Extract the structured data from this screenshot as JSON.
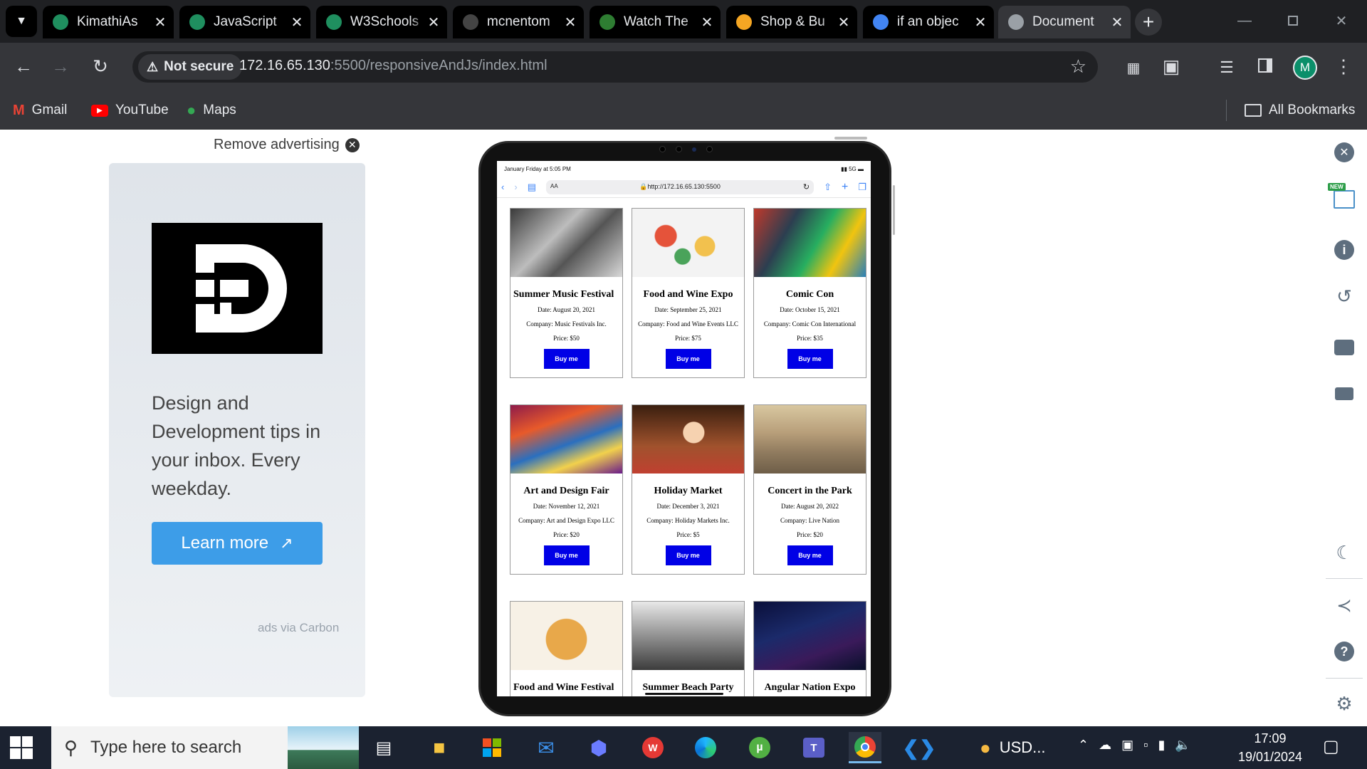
{
  "tabs": [
    {
      "title": "KimathiAs",
      "icon": "webflow-icon",
      "color": "#1f8f5f"
    },
    {
      "title": "JavaScript",
      "icon": "webflow-icon",
      "color": "#1f8f5f"
    },
    {
      "title": "W3Schools",
      "icon": "webflow-icon",
      "color": "#1f8f5f"
    },
    {
      "title": "mcnentom",
      "icon": "github-icon",
      "color": "#444"
    },
    {
      "title": "Watch The",
      "icon": "play-icon",
      "color": "#2e7d32"
    },
    {
      "title": "Shop & Bu",
      "icon": "star-icon",
      "color": "#f5a623"
    },
    {
      "title": "if an objec",
      "icon": "google-icon",
      "color": "#4285f4"
    },
    {
      "title": "Document",
      "icon": "globe-icon",
      "color": "#9aa0a6"
    }
  ],
  "address": {
    "security": "Not secure",
    "host": "172.16.65.130",
    "path": ":5500/responsiveAndJs/index.html"
  },
  "profile_initial": "M",
  "bookmarks": [
    {
      "label": "Gmail"
    },
    {
      "label": "YouTube"
    },
    {
      "label": "Maps"
    }
  ],
  "all_bookmarks": "All Bookmarks",
  "ad": {
    "remove": "Remove advertising",
    "text": "Design and Development tips in your inbox. Every weekday.",
    "button": "Learn more",
    "via": "ads via Carbon"
  },
  "device": {
    "status_left": "January Friday at 5:05 PM",
    "status_right": "5G",
    "url": "http://172.16.65.130:5500",
    "text_size": "AA"
  },
  "events": [
    {
      "title": "Summer Music Festival",
      "date": "Date: August 20, 2021",
      "company": "Company: Music Festivals Inc.",
      "price": "Price: $50",
      "button": "Buy me"
    },
    {
      "title": "Food and Wine Expo",
      "date": "Date: September 25, 2021",
      "company": "Company: Food and Wine Events LLC",
      "price": "Price: $75",
      "button": "Buy me"
    },
    {
      "title": "Comic Con",
      "date": "Date: October 15, 2021",
      "company": "Company: Comic Con International",
      "price": "Price: $35",
      "button": "Buy me"
    },
    {
      "title": "Art and Design Fair",
      "date": "Date: November 12, 2021",
      "company": "Company: Art and Design Expo LLC",
      "price": "Price: $20",
      "button": "Buy me"
    },
    {
      "title": "Holiday Market",
      "date": "Date: December 3, 2021",
      "company": "Company: Holiday Markets Inc.",
      "price": "Price: $5",
      "button": "Buy me"
    },
    {
      "title": "Concert in the Park",
      "date": "Date: August 20, 2022",
      "company": "Company: Live Nation",
      "price": "Price: $20",
      "button": "Buy me"
    },
    {
      "title": "Food and Wine Festival",
      "date": "",
      "company": "",
      "price": "",
      "button": ""
    },
    {
      "title": "Summer Beach Party",
      "date": "",
      "company": "",
      "price": "",
      "button": ""
    },
    {
      "title": "Angular Nation Expo",
      "date": "",
      "company": "",
      "price": "",
      "button": ""
    }
  ],
  "sidebar": {
    "new_badge": "NEW"
  },
  "taskbar": {
    "search_placeholder": "Type here to search",
    "currency": "USD...",
    "time": "17:09",
    "date": "19/01/2024"
  }
}
